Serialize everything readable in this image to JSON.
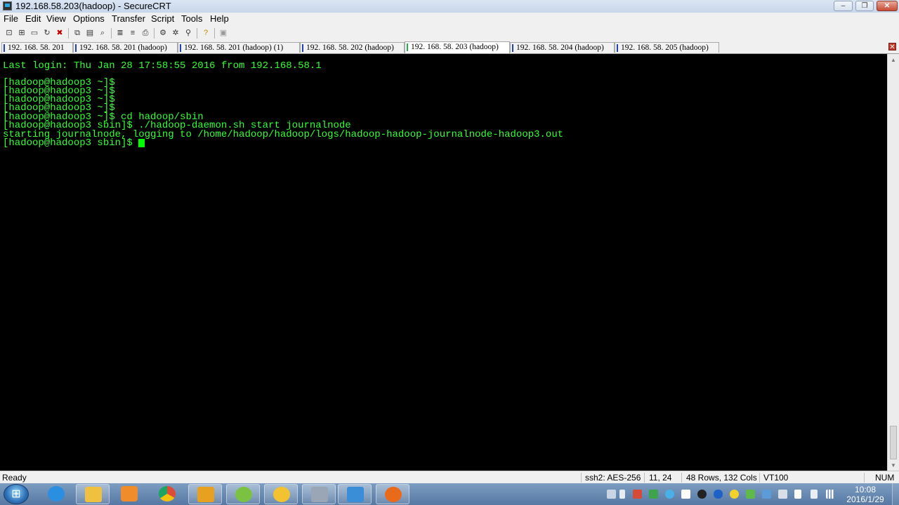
{
  "window": {
    "title": "192.168.58.203(hadoop) - SecureCRT",
    "controls": {
      "minimize": "–",
      "maximize": "❐",
      "close": "✕"
    }
  },
  "menu": {
    "items": [
      "File",
      "Edit",
      "View",
      "Options",
      "Transfer",
      "Script",
      "Tools",
      "Help"
    ]
  },
  "toolbar": {
    "icons": [
      "connect-icon",
      "quick-connect-icon",
      "connect-in-tab-icon",
      "reconnect-icon",
      "disconnect-icon",
      "copy-icon",
      "paste-icon",
      "find-icon",
      "send-ascii-icon",
      "receive-ascii-icon",
      "print-icon",
      "session-options-icon",
      "sftp-icon",
      "keymap-icon",
      "help-icon",
      "options-icon"
    ]
  },
  "tabs": [
    {
      "label": "192. 168. 58. 201",
      "active": false
    },
    {
      "label": "192. 168. 58. 201 (hadoop)",
      "active": false
    },
    {
      "label": "192. 168. 58. 201 (hadoop)   (1)",
      "active": false
    },
    {
      "label": "192. 168. 58. 202 (hadoop)",
      "active": false
    },
    {
      "label": "192. 168. 58. 203 (hadoop)",
      "active": true
    },
    {
      "label": "192. 168. 58. 204 (hadoop)",
      "active": false
    },
    {
      "label": "192. 168. 58. 205 (hadoop)",
      "active": false
    }
  ],
  "tab_close": "✕",
  "terminal": {
    "text_color": "#33ff33",
    "background": "#000000",
    "lines": [
      "Last login: Thu Jan 28 17:58:55 2016 from 192.168.58.1",
      "",
      "[hadoop@hadoop3 ~]$",
      "[hadoop@hadoop3 ~]$",
      "[hadoop@hadoop3 ~]$",
      "[hadoop@hadoop3 ~]$",
      "[hadoop@hadoop3 ~]$ cd hadoop/sbin",
      "[hadoop@hadoop3 sbin]$ ./hadoop-daemon.sh start journalnode",
      "starting journalnode, logging to /home/hadoop/hadoop/logs/hadoop-hadoop-journalnode-hadoop3.out"
    ],
    "prompt": "[hadoop@hadoop3 sbin]$ "
  },
  "status": {
    "ready": "Ready",
    "encryption": "ssh2: AES-256",
    "position": "11,  24",
    "size": "48 Rows, 132 Cols",
    "terminal_type": "VT100",
    "num": "NUM"
  },
  "taskbar": {
    "apps": [
      {
        "name": "internet-explorer",
        "color": "#2a8fe0"
      },
      {
        "name": "file-explorer",
        "color": "#f0c040"
      },
      {
        "name": "media-player",
        "color": "#f08c2a"
      },
      {
        "name": "chrome",
        "color": "#dd4b39"
      },
      {
        "name": "toolbox",
        "color": "#e8a020"
      },
      {
        "name": "refresh-app",
        "color": "#7cc242"
      },
      {
        "name": "e-app",
        "color": "#f2c230"
      },
      {
        "name": "printer-app",
        "color": "#9aa5b5"
      },
      {
        "name": "securecrt",
        "color": "#3a8ed8"
      },
      {
        "name": "game-app",
        "color": "#e86a1a"
      }
    ],
    "clock": {
      "time": "10:08",
      "date": "2016/1/29"
    }
  }
}
